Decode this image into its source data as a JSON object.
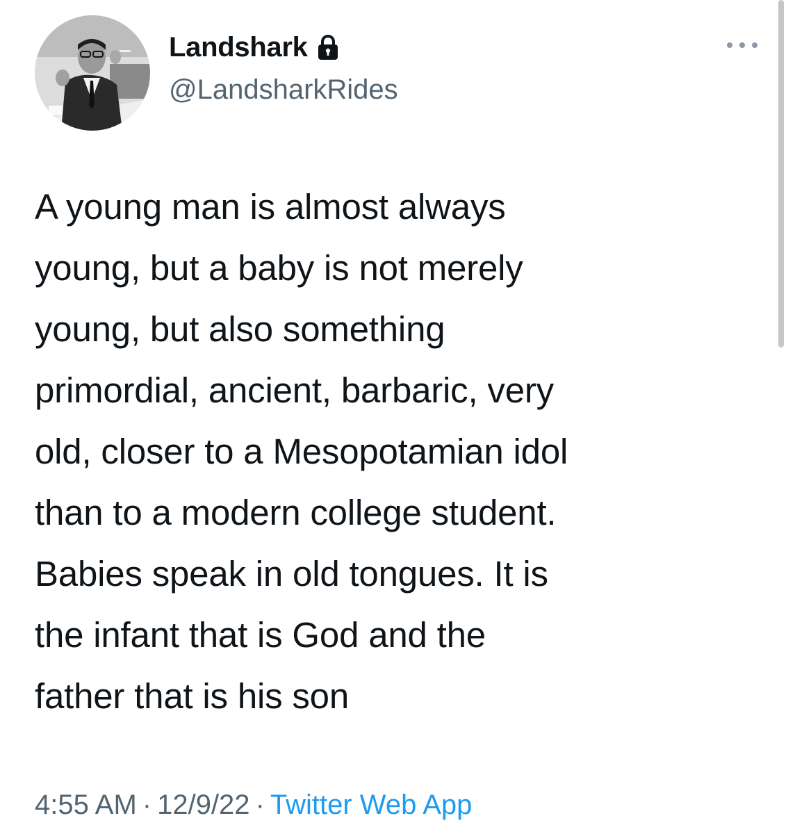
{
  "author": {
    "display_name": "Landshark",
    "handle": "@LandsharkRides",
    "protected_icon": "lock-icon",
    "avatar_icon": "profile-photo"
  },
  "menu": {
    "icon": "more-horizontal-icon"
  },
  "tweet": {
    "lines": [
      "A young man is almost always",
      "young, but a baby is not merely",
      "young, but also something",
      "primordial, ancient, barbaric, very",
      "old, closer to a Mesopotamian idol",
      "than to a modern college student.",
      "Babies speak in old tongues. It is",
      "the infant that is God and the",
      "father that is his son"
    ]
  },
  "meta": {
    "time": "4:55 AM",
    "date": "12/9/22",
    "separator": "·",
    "source": "Twitter Web App"
  },
  "colors": {
    "text": "#0f1419",
    "secondary": "#536471",
    "link": "#1d9bf0"
  }
}
